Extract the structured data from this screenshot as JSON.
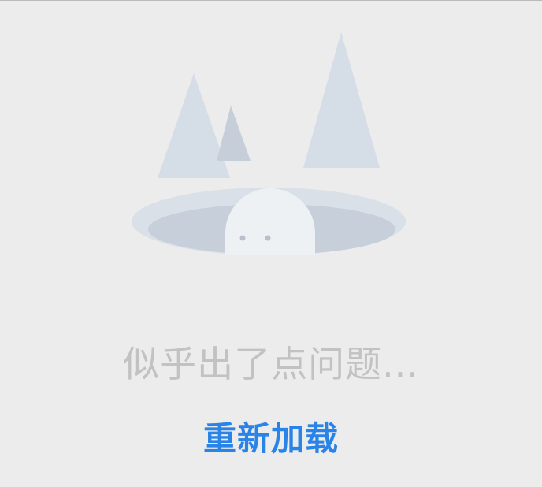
{
  "error_state": {
    "illustration_icon": "ghost-in-hole-illustration",
    "message": "似乎出了点问题...",
    "reload_label": "重新加载"
  },
  "colors": {
    "background": "#ececec",
    "message_text": "#c2c2c2",
    "reload_link": "#2a84e8",
    "illustration_light": "#d5dde6",
    "illustration_mid": "#c9d2dc",
    "ghost": "#eef1f4"
  }
}
